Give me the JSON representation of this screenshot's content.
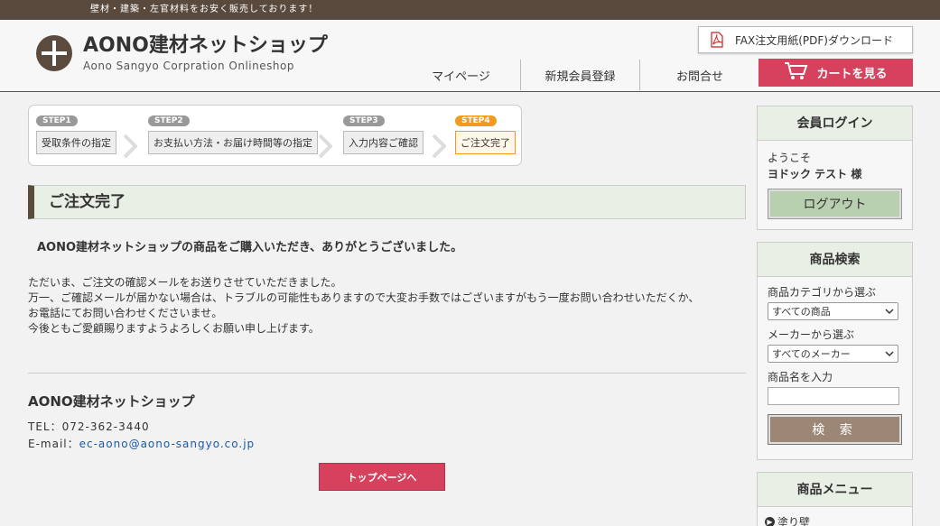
{
  "topbar": {
    "text": "壁材・建築・左官材料をお安く販売しております！"
  },
  "header": {
    "logo_title": "AONO建材ネットショップ",
    "logo_sub": "Aono Sangyo  Corpration  Onlineshop",
    "fax_label": "FAX注文用紙(PDF)ダウンロード",
    "nav": {
      "mypage": "マイページ",
      "register": "新規会員登録",
      "contact": "お問合せ"
    },
    "cart_label": "カートを見る"
  },
  "steps": [
    {
      "badge": "STEP1",
      "label": "受取条件の指定"
    },
    {
      "badge": "STEP2",
      "label": "お支払い方法・お届け時間等の指定"
    },
    {
      "badge": "STEP3",
      "label": "入力内容ご確認"
    },
    {
      "badge": "STEP4",
      "label": "ご注文完了"
    }
  ],
  "main": {
    "title": "ご注文完了",
    "thanks": "AONO建材ネットショップの商品をご購入いただき、ありがとうございました。",
    "body_lines": [
      "ただいま、ご注文の確認メールをお送りさせていただきました。",
      "万一、ご確認メールが届かない場合は、トラブルの可能性もありますので大変お手数ではございますがもう一度お問い合わせいただくか、",
      "お電話にてお問い合わせくださいませ。",
      "今後ともご愛顧賜りますようよろしくお願い申し上げます。"
    ],
    "shop_name": "AONO建材ネットショップ",
    "tel": "TEL：072-362-3440",
    "email_label": "E-mail：",
    "email": "ec-aono@aono-sangyo.co.jp",
    "top_button": "トップページへ"
  },
  "sidebar": {
    "login": {
      "title": "会員ログイン",
      "welcome": "ようこそ",
      "name": "ヨドック テスト 様",
      "logout": "ログアウト"
    },
    "search": {
      "title": "商品検索",
      "category_label": "商品カテゴリから選ぶ",
      "category_value": "すべての商品",
      "maker_label": "メーカーから選ぶ",
      "maker_value": "すべてのメーカー",
      "name_label": "商品名を入力",
      "name_value": "",
      "search_button": "検 索"
    },
    "menu": {
      "title": "商品メニュー",
      "items": [
        "塗り壁"
      ]
    }
  }
}
